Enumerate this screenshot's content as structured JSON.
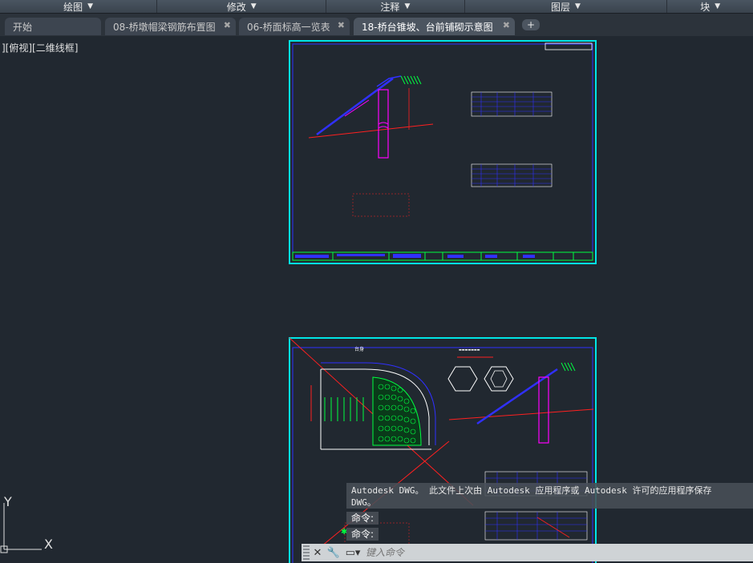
{
  "ribbon": {
    "panels": [
      {
        "label": "绘图"
      },
      {
        "label": "修改"
      },
      {
        "label": "注释"
      },
      {
        "label": "图层"
      },
      {
        "label": "块"
      }
    ]
  },
  "tabs": [
    {
      "label": "开始"
    },
    {
      "label": "08-桥墩帽梁钢筋布置图"
    },
    {
      "label": "06-桥面标高一览表"
    },
    {
      "label": "18-桥台锥坡、台前铺砌示意图"
    }
  ],
  "add_tab": "+",
  "viewport": {
    "label": "][俯视][二维线框]"
  },
  "sheet_bottom": {
    "title": "台身"
  },
  "ucs": {
    "y_label": "Y",
    "x_label": "X"
  },
  "command": {
    "history_line1": "Autodesk DWG。  此文件上次由 Autodesk 应用程序或 Autodesk 许可的应用程序保存",
    "history_line2": "DWG。",
    "prompt1": "命令:",
    "prompt2": "命令:",
    "input_placeholder": "键入命令"
  },
  "colors": {
    "background": "#212830",
    "frame": "#00e5e5",
    "accent_red": "#ff2020",
    "accent_magenta": "#ff00ff",
    "accent_green": "#00ff40",
    "accent_blue": "#3030ff"
  }
}
